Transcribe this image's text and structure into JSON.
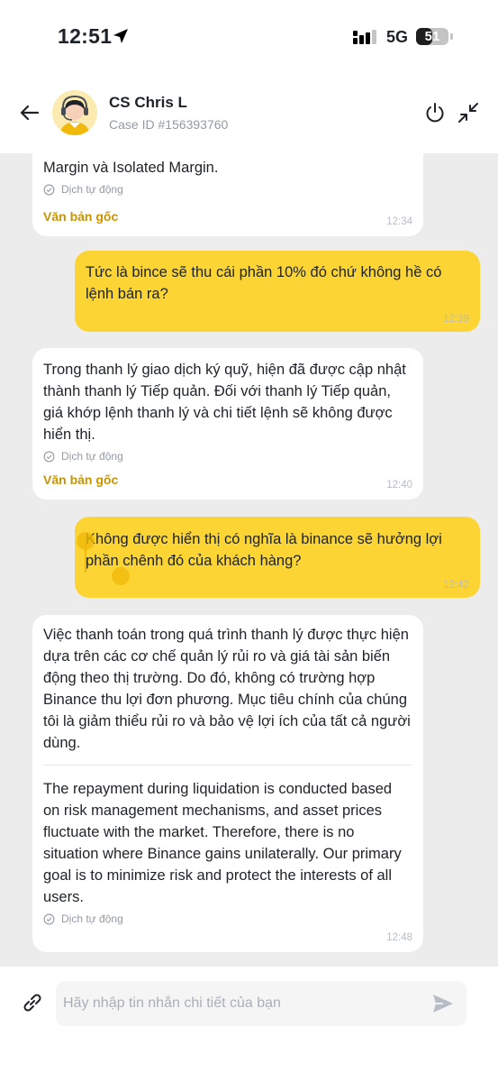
{
  "status_bar": {
    "time": "12:51",
    "network": "5G",
    "battery": "51",
    "battery_level_percent": 51
  },
  "header": {
    "agent_name": "CS Chris L",
    "case_id": "Case ID #156393760"
  },
  "messages": [
    {
      "sender": "agent",
      "partial_line": "Margin và Isolated Margin.",
      "auto_label": "Dịch tự động",
      "original_link": "Văn bản gốc",
      "time": "12:34"
    },
    {
      "sender": "user",
      "text": "Tức là bince sẽ thu cái phần 10% đó chứ không hề có lệnh bán ra?",
      "time": "12:39"
    },
    {
      "sender": "agent",
      "text": "Trong thanh lý giao dịch ký quỹ, hiện đã được cập nhật thành thanh lý Tiếp quản. Đối với thanh lý Tiếp quản, giá khớp lệnh thanh lý và chi tiết lệnh sẽ không được hiển thị.",
      "auto_label": "Dịch tự động",
      "original_link": "Văn bản gốc",
      "time": "12:40"
    },
    {
      "sender": "user",
      "text": "Không được hiển thị có nghĩa là binance sẽ hưởng lợi phần chênh đó của khách hàng?",
      "time": "12:42"
    },
    {
      "sender": "agent",
      "text": "Việc thanh toán trong quá trình thanh lý được thực hiện dựa trên các cơ chế quản lý rủi ro và giá tài sản biến động theo thị trường. Do đó, không có trường hợp Binance thu lợi đơn phương. Mục tiêu chính của chúng tôi là giảm thiểu rủi ro và bảo vệ lợi ích của tất cả người dùng.",
      "text_en": "The repayment during liquidation is conducted based on risk management mechanisms, and asset prices fluctuate with the market. Therefore, there is no situation where Binance gains unilaterally. Our primary goal is to minimize risk and protect the interests of all users.",
      "auto_label": "Dịch tự động",
      "time": "12:48"
    }
  ],
  "input": {
    "placeholder": "Hãy nhập tin nhắn chi tiết của bạn",
    "value": ""
  },
  "colors": {
    "accent": "#fcd535",
    "link": "#c99400",
    "chat_background": "#ececec",
    "muted_text": "#929aa5"
  },
  "icons": {
    "back": "arrow-left-icon",
    "power": "power-icon",
    "minimize": "minimize-icon",
    "attach": "link-icon",
    "send": "send-icon",
    "location": "location-arrow-icon",
    "signal": "signal-bars-icon",
    "auto_translate": "check-circle-icon"
  }
}
